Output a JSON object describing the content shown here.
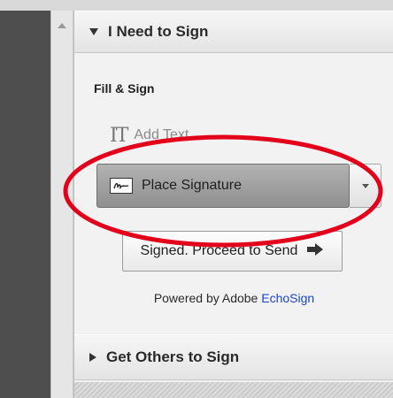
{
  "panel": {
    "section1_title": "I Need to Sign",
    "subsection_title": "Fill & Sign",
    "add_text_label": "Add Text",
    "place_signature_label": "Place Signature",
    "send_button_label": "Signed. Proceed to Send",
    "powered_prefix": "Powered by Adobe",
    "powered_brand": "EchoSign",
    "section2_title": "Get Others to Sign"
  },
  "colors": {
    "highlight": "#e2001a",
    "brand_link": "#1a46c8"
  },
  "icons": {
    "section1_toggle": "triangle-down-icon",
    "section2_toggle": "triangle-right-icon",
    "add_text": "text-tool-icon",
    "signature": "signature-icon",
    "send_arrow": "arrow-right-icon",
    "dropdown": "chevron-down-icon",
    "scroll_up": "scroll-up-icon"
  }
}
